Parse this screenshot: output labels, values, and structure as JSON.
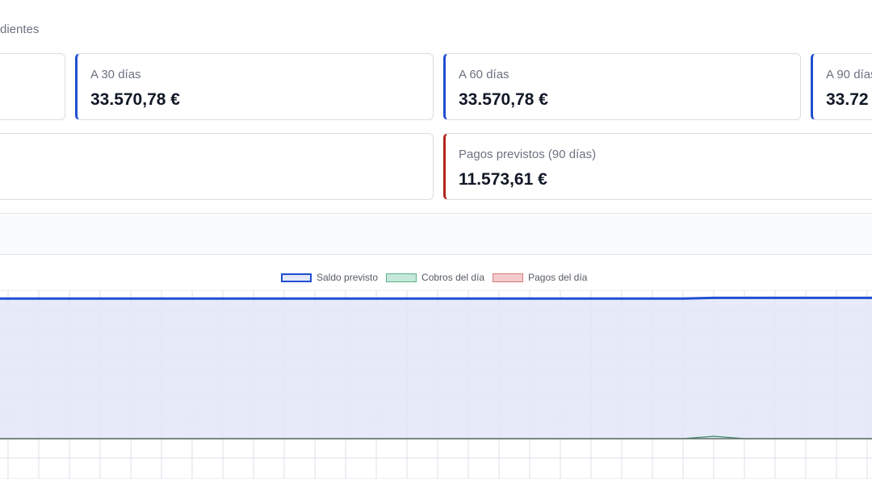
{
  "header": {
    "subtitle": "dientes"
  },
  "cards": {
    "d30": {
      "label": "A 30 días",
      "value": "33.570,78 €"
    },
    "d60": {
      "label": "A 60 días",
      "value": "33.570,78 €"
    },
    "d90": {
      "label": "A 90 días",
      "value": "33.72"
    },
    "pagos": {
      "label": "Pagos previstos (90 días)",
      "value": "11.573,61 €"
    }
  },
  "colors": {
    "accent_blue": "#1f4fd1",
    "accent_red": "#b3261e",
    "saldo_fill": "#e4e8f8",
    "cobros_fill": "#c6e8d8",
    "pagos_fill": "#f2cccc"
  },
  "chart_data": {
    "type": "line",
    "legend_position": "top",
    "grid": true,
    "series": [
      {
        "name": "Saldo previsto",
        "values": [
          33570.78,
          33570.78,
          33570.78,
          33570.78,
          33570.78,
          33570.78,
          33570.78,
          33570.78,
          33570.78,
          33570.78,
          33570.78,
          33570.78,
          33570.78,
          33570.78,
          33570.78,
          33570.78,
          33570.78,
          33570.78,
          33570.78,
          33570.78,
          33570.78,
          33570.78,
          33570.78,
          33724,
          33724,
          33724,
          33724,
          33724,
          33724
        ]
      },
      {
        "name": "Cobros del día",
        "values": [
          0,
          0,
          0,
          0,
          0,
          0,
          0,
          0,
          0,
          0,
          0,
          0,
          0,
          0,
          0,
          0,
          0,
          0,
          0,
          0,
          0,
          0,
          0,
          150,
          0,
          0,
          0,
          0,
          0
        ]
      },
      {
        "name": "Pagos del día",
        "values": [
          0,
          0,
          0,
          0,
          0,
          0,
          0,
          0,
          0,
          0,
          0,
          0,
          0,
          0,
          0,
          0,
          0,
          0,
          0,
          0,
          0,
          0,
          0,
          0,
          0,
          0,
          0,
          0,
          0
        ]
      }
    ]
  }
}
